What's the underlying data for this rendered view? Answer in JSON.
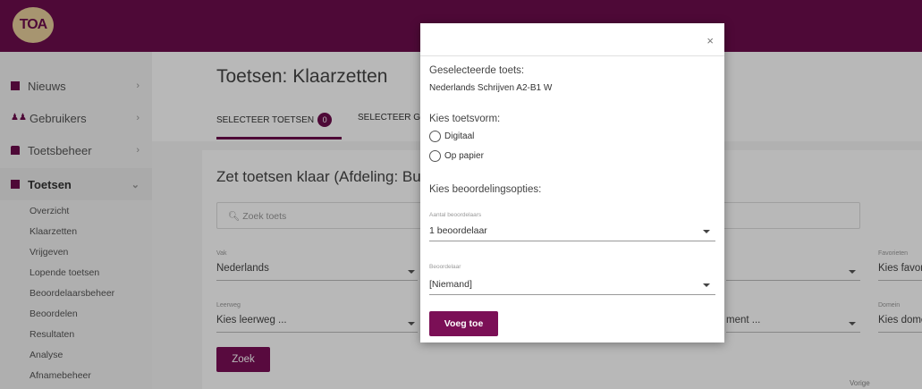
{
  "logo": {
    "text": "TOA"
  },
  "sidebar": {
    "items": [
      {
        "label": "Nieuws",
        "icon": "news-icon"
      },
      {
        "label": "Gebruikers",
        "icon": "users-icon"
      },
      {
        "label": "Toetsbeheer",
        "icon": "folder-icon"
      },
      {
        "label": "Toetsen",
        "icon": "test-icon"
      }
    ],
    "subitems": [
      "Overzicht",
      "Klaarzetten",
      "Vrijgeven",
      "Lopende toetsen",
      "Beoordelaarsbeheer",
      "Beoordelen",
      "Resultaten",
      "Analyse",
      "Afnamebeheer"
    ]
  },
  "page": {
    "title": "Toetsen: Klaarzetten",
    "tabs": [
      {
        "label": "SELECTEER TOETSEN",
        "badge": "0"
      },
      {
        "label": "SELECTEER GR"
      }
    ],
    "card_title": "Zet toetsen klaar (Afdeling: Bu",
    "search_placeholder": "Zoek toets",
    "filters": {
      "vak_label": "Vak",
      "vak_value": "Nederlands",
      "leerweg_label": "Leerweg",
      "leerweg_value": "Kies leerweg ...",
      "favorieten_label": "Favorieten",
      "favorieten_value": "Kies favor",
      "domein_label": "Domein",
      "domein_value": "Kies dome",
      "middle_value": "ment ..."
    },
    "zoek_button": "Zoek",
    "footer_text": "Vorige"
  },
  "modal": {
    "close": "×",
    "selected_heading": "Geselecteerde toets:",
    "selected_test": "Nederlands Schrijven A2-B1 W",
    "form_heading": "Kies toetsvorm:",
    "options": [
      "Digitaal",
      "Op papier"
    ],
    "assessment_heading": "Kies beoordelingsopties:",
    "aantal_label": "Aantal beoordelaars",
    "aantal_value": "1 beoordelaar",
    "beoordelaar_label": "Beoordelaar",
    "beoordelaar_value": "[Niemand]",
    "add_button": "Voeg toe"
  },
  "colors": {
    "brand": "#6d0d4d",
    "button": "#7b0f56"
  }
}
